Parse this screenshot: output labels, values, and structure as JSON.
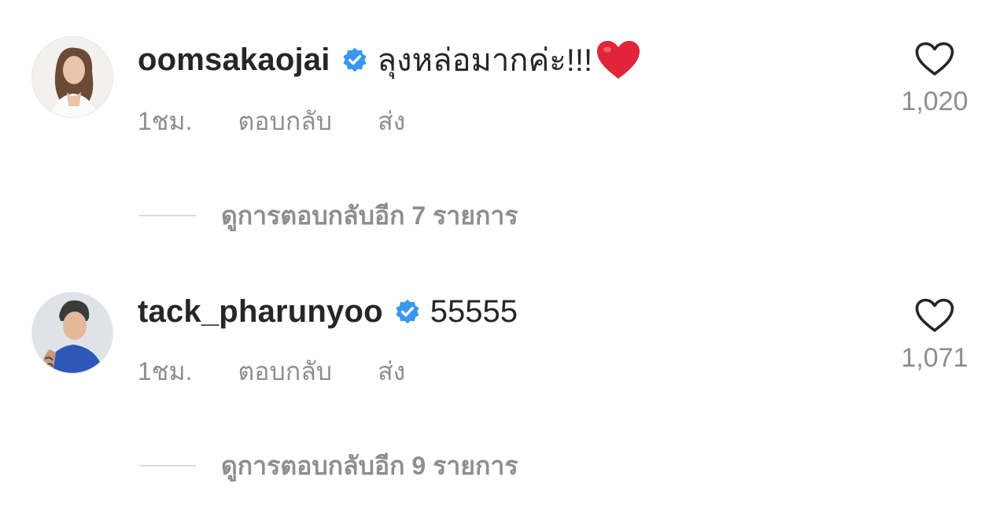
{
  "comments": [
    {
      "username": "oomsakaojai",
      "verified": true,
      "text": "ลุงหล่อมากค่ะ!!!",
      "emoji": "red-heart",
      "time": "1ชม.",
      "reply_label": "ตอบกลับ",
      "send_label": "ส่ง",
      "likes": "1,020",
      "view_replies": "ดูการตอบกลับอีก 7 รายการ"
    },
    {
      "username": "tack_pharunyoo",
      "verified": true,
      "text": "55555",
      "time": "1ชม.",
      "reply_label": "ตอบกลับ",
      "send_label": "ส่ง",
      "likes": "1,071",
      "view_replies": "ดูการตอบกลับอีก 9 รายการ"
    }
  ],
  "colors": {
    "text_primary": "#262626",
    "text_secondary": "#8e8e8e",
    "verified_blue": "#3897f0",
    "divider": "#dbdbdb",
    "emoji_red": "#e0243a"
  },
  "icons": {
    "verified": "verified-badge-icon",
    "like": "heart-outline-icon",
    "emoji": "red-heart-emoji-icon"
  }
}
